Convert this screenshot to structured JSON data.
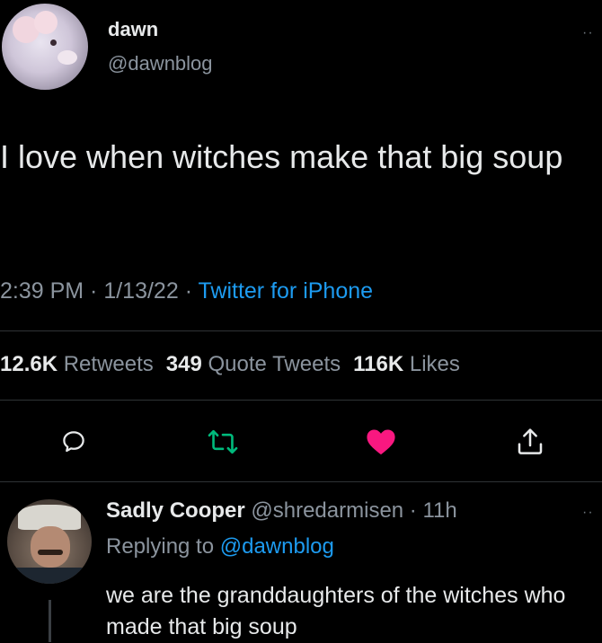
{
  "tweet": {
    "author_name": "dawn",
    "author_handle": "@dawnblog",
    "more": "··",
    "text": "I love when witches make that big soup",
    "time": "2:39 PM",
    "sep1": " · ",
    "date": "1/13/22",
    "sep2": " · ",
    "source": "Twitter for iPhone",
    "stats": {
      "retweets_count": "12.6K",
      "retweets_label": "Retweets",
      "quotes_count": "349",
      "quotes_label": "Quote Tweets",
      "likes_count": "116K",
      "likes_label": "Likes"
    },
    "actions": {
      "reply_icon": "comment-icon",
      "retweet_icon": "retweet-icon",
      "like_icon": "heart-icon",
      "share_icon": "share-icon"
    }
  },
  "reply": {
    "author_name": "Sadly Cooper",
    "author_handle": "@shredarmisen",
    "sep": " · ",
    "age": "11h",
    "more": "··",
    "replying_prefix": "Replying to ",
    "replying_to": "@dawnblog",
    "text": "we are the granddaughters of the witches who made that big soup"
  },
  "colors": {
    "background": "#000000",
    "text": "#e7e9ea",
    "secondary": "#8b949e",
    "link": "#1d9bf0",
    "retweet_green": "#00ba7c",
    "like_pink": "#f91880"
  }
}
